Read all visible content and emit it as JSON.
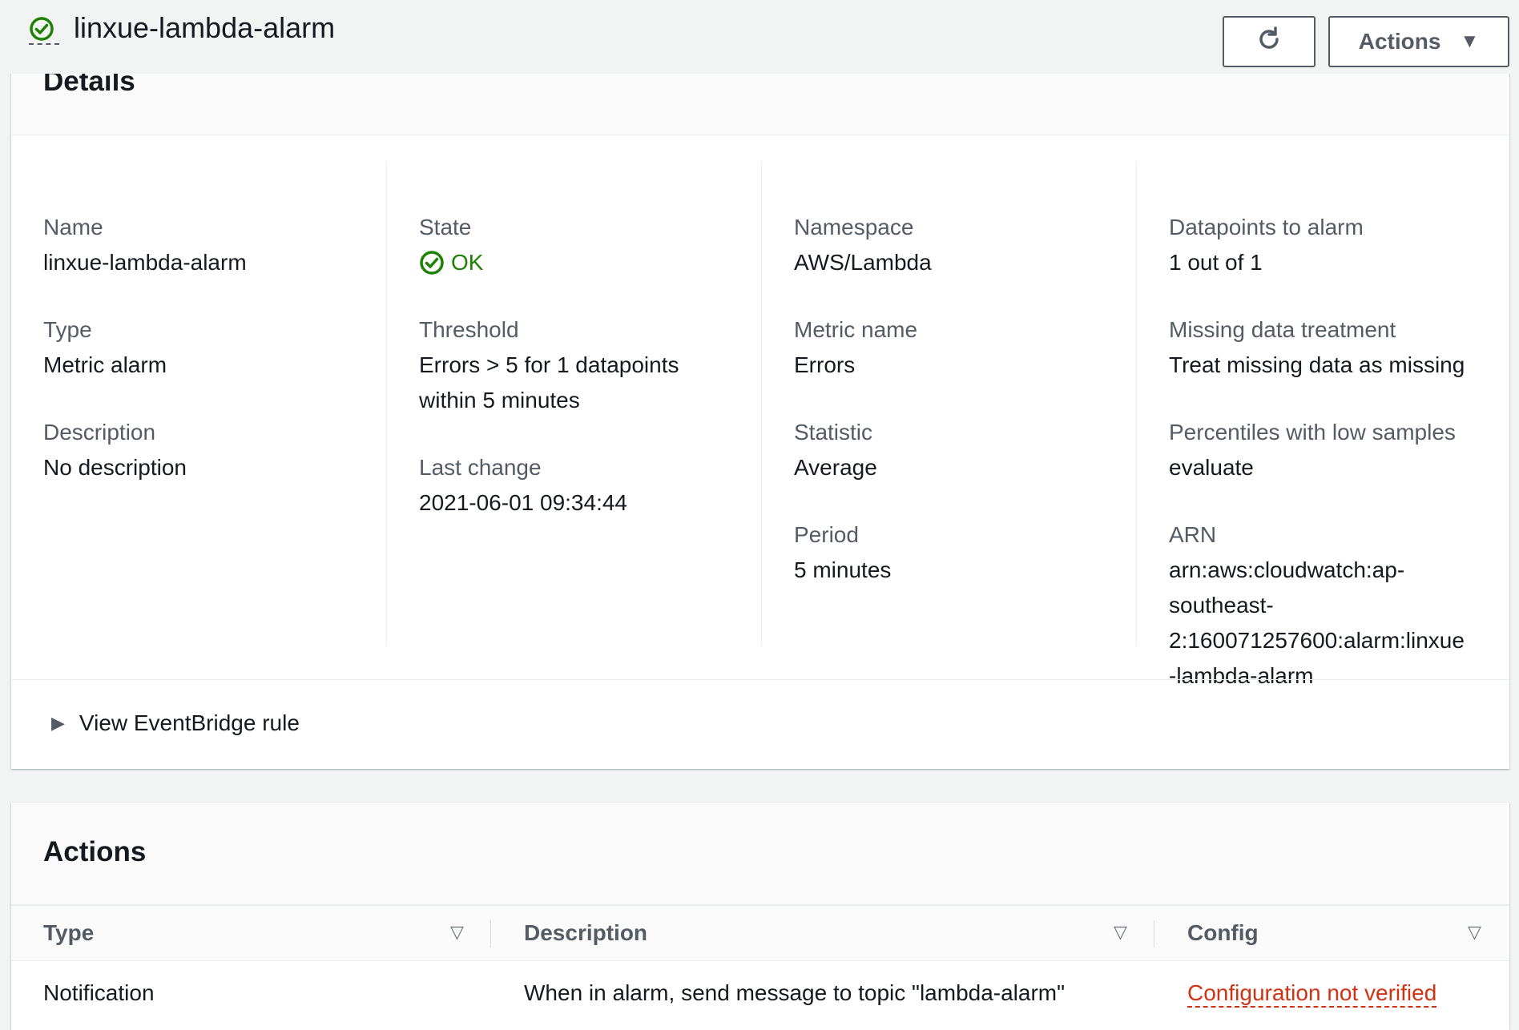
{
  "header": {
    "title": "linxue-lambda-alarm",
    "refresh_label": "",
    "actions_label": "Actions"
  },
  "details": {
    "title": "Details",
    "name_label": "Name",
    "name_value": "linxue-lambda-alarm",
    "type_label": "Type",
    "type_value": "Metric alarm",
    "description_label": "Description",
    "description_value": "No description",
    "state_label": "State",
    "state_value": "OK",
    "threshold_label": "Threshold",
    "threshold_line1": "Errors > 5 for 1 datapoints",
    "threshold_line2": "within 5 minutes",
    "last_change_label": "Last change",
    "last_change_value": "2021-06-01 09:34:44",
    "namespace_label": "Namespace",
    "namespace_value": "AWS/Lambda",
    "metric_name_label": "Metric name",
    "metric_name_value": "Errors",
    "statistic_label": "Statistic",
    "statistic_value": "Average",
    "period_label": "Period",
    "period_value": "5 minutes",
    "datapoints_label": "Datapoints to alarm",
    "datapoints_value": "1 out of 1",
    "missing_label": "Missing data treatment",
    "missing_value": "Treat missing data as missing",
    "percentiles_label": "Percentiles with low samples",
    "percentiles_value": "evaluate",
    "arn_label": "ARN",
    "arn_line1": "arn:aws:cloudwatch:ap-",
    "arn_line2": "southeast-",
    "arn_line3": "2:160071257600:alarm:linxue",
    "arn_line4": "-lambda-alarm",
    "eventbridge_label": "View EventBridge rule"
  },
  "actions": {
    "title": "Actions",
    "columns": [
      "Type",
      "Description",
      "Config"
    ],
    "rows": [
      {
        "type": "Notification",
        "description": "When in alarm, send message to topic \"lambda-alarm\"",
        "config": "Configuration not verified"
      }
    ]
  },
  "colors": {
    "ok_green": "#1d8102",
    "warning_red": "#d13212",
    "text_secondary": "#545b64"
  }
}
